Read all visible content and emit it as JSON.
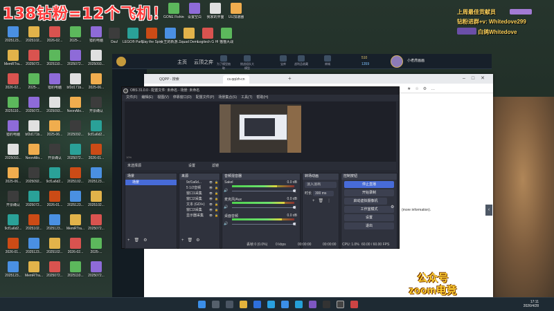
{
  "overlay": {
    "top_left_banner": "138钻粉=12个飞机！",
    "top_right_line1": "上周最佳贡献员",
    "top_right_line2": "钻粉进群+v: Whitedove299",
    "top_right_line3": "白鸽Whitedove",
    "bottom_watermark_line1": "公众号",
    "bottom_watermark_line2": "zoom电竞"
  },
  "desktop_icons": [
    {
      "label": "2025123..."
    },
    {
      "label": "MemRTra..."
    },
    {
      "label": "2026-02..."
    },
    {
      "label": "2025110..."
    },
    {
      "label": "猎豹电脑"
    },
    {
      "label": "2025093..."
    },
    {
      "label": "2025-06..."
    },
    {
      "label": "开票确认"
    },
    {
      "label": "9cf1a6d2..."
    },
    {
      "label": "2026-01..."
    },
    {
      "label": "2025123..."
    },
    {
      "label": "2025102..."
    },
    {
      "label": "2025072..."
    },
    {
      "label": "2025-..."
    },
    {
      "label": "2025072..."
    },
    {
      "label": "bf2d171b..."
    },
    {
      "label": "NeonAllo..."
    },
    {
      "label": "2025092..."
    },
    {
      "label": "2025072..."
    },
    {
      "label": "2025102..."
    }
  ],
  "top_icons": [
    {
      "label": "GONE Fishing"
    },
    {
      "label": "设置空白"
    },
    {
      "label": "我家的界面"
    },
    {
      "label": "UU加速器"
    },
    {
      "label": "Osu!"
    },
    {
      "label": "LEGO® Party!"
    },
    {
      "label": "Slay the Spire 2"
    },
    {
      "label": "女王的新游..."
    },
    {
      "label": "Squad Demo"
    },
    {
      "label": "Logitech G HUB"
    },
    {
      "label": "猫猫大战"
    }
  ],
  "launcher": {
    "nav_home": "主页",
    "nav_main": "云顶之弈",
    "currency": "510",
    "currency2": "1359",
    "user": "小老虎画画",
    "tiles": [
      "为了模型抽取",
      "挑战组队大模型",
      "宝库",
      "战利品收藏",
      "商城"
    ]
  },
  "browser": {
    "tab1": "QQPP - 搜索",
    "tab2": "cs.qq/zh-cn",
    "page_text": "(more information)."
  },
  "obs": {
    "title": "OBS 31.0.0 - 配置文件: 未命名 - 场景: 未命名",
    "menu": [
      "文件(F)",
      "编辑(E)",
      "视图(V)",
      "停靠窗口(D)",
      "配置文件(P)",
      "场景集合(S)",
      "工具(T)",
      "帮助(H)"
    ],
    "preview_label": "未选择源",
    "preview_buttons": [
      "设置",
      "滤镜"
    ],
    "panels": {
      "scenes": "场景",
      "sources": "来源",
      "mixer": "音频混音器",
      "transitions": "转场动画",
      "controls": "控制按钮"
    },
    "scene_list": [
      "场景"
    ],
    "source_list": [
      "9cf1a6d...",
      "5 1/2音频",
      "窗口1采集",
      "窗口2采集",
      "文本 (GDI+)",
      "窗口3采集",
      "显示器采集"
    ],
    "mixer_channels": [
      {
        "name": "Sakel",
        "db": "0.0 dB",
        "level": 0.72
      },
      {
        "name": "麦克风/Aux",
        "db": "0.0 dB",
        "level": 0.84
      },
      {
        "name": "桌面音频",
        "db": "0.0 dB",
        "level": 0.8
      }
    ],
    "transition": {
      "type": "淡入淡出",
      "duration_label": "时长",
      "duration": "300 ms"
    },
    "controls": [
      "停止直播",
      "开始录制",
      "启动虚拟摄像机",
      "工作室模式",
      "设置",
      "退出"
    ],
    "status": {
      "dropped": "丢帧 0 (0.0%)",
      "kbps": "0 kbps",
      "live_time": "00:00:00",
      "rec_time": "00:00:00",
      "cpu": "CPU: 1.0%",
      "fps": "60.00 / 60.00 FPS"
    }
  },
  "taskbar": {
    "time": "17:11",
    "date": "2026/4/28"
  },
  "colors": {
    "accent_blue": "#476bd8",
    "banner_red": "#ff3b3b",
    "watermark_yellow": "#ffcf33"
  }
}
